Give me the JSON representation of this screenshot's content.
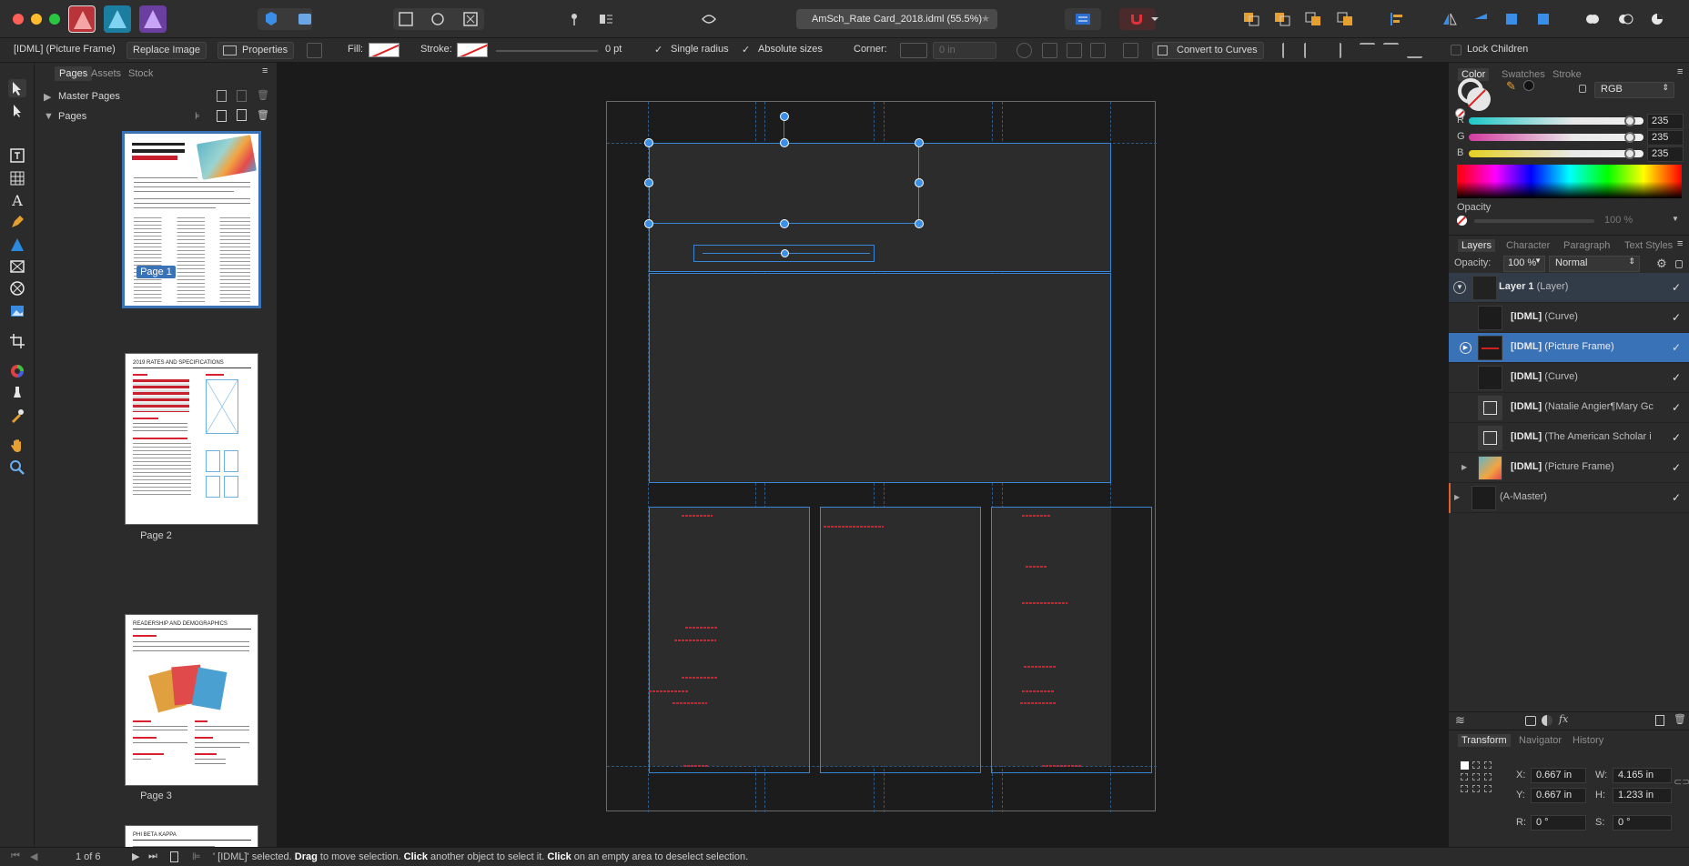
{
  "window": {
    "document_tab": "AmSch_Rate Card_2018.idml (55.5%)"
  },
  "context_toolbar": {
    "selection_type": "[IDML] (Picture Frame)",
    "replace_image": "Replace Image",
    "properties": "Properties",
    "fill_label": "Fill:",
    "stroke_label": "Stroke:",
    "stroke_value": "0 pt",
    "single_radius": "Single radius",
    "absolute_sizes": "Absolute sizes",
    "corner_label": "Corner:",
    "corner_value": "0 in",
    "convert_to_curves": "Convert to Curves",
    "lock_children": "Lock Children"
  },
  "pages_panel": {
    "tabs": [
      "Pages",
      "Assets",
      "Stock"
    ],
    "master_pages": "Master Pages",
    "pages": "Pages",
    "page_labels": [
      "Page 1",
      "Page 2",
      "Page 3"
    ],
    "thumb_titles": {
      "page2": "2019 RATES AND SPECIFICATIONS",
      "page3": "READERSHIP AND DEMOGRAPHICS",
      "page4": "PHI BETA KAPPA"
    }
  },
  "color_panel": {
    "tabs": [
      "Color",
      "Swatches",
      "Stroke"
    ],
    "mode": "RGB",
    "r_label": "R",
    "g_label": "G",
    "b_label": "B",
    "r": "235",
    "g": "235",
    "b": "235",
    "r_fraction": 0.92,
    "g_fraction": 0.92,
    "b_fraction": 0.92,
    "opacity_label": "Opacity",
    "opacity_value": "100 %"
  },
  "layers_panel": {
    "tabs": [
      "Layers",
      "Character",
      "Paragraph",
      "Text Styles"
    ],
    "opacity_label": "Opacity:",
    "opacity_value": "100 %",
    "blend_mode": "Normal",
    "layers": [
      {
        "name": "Layer 1",
        "type": "(Layer)"
      },
      {
        "name": "[IDML]",
        "type": "(Curve)"
      },
      {
        "name": "[IDML]",
        "type": "(Picture Frame)"
      },
      {
        "name": "[IDML]",
        "type": "(Curve)"
      },
      {
        "name": "[IDML]",
        "type": "(Natalie Angier¶Mary Gc"
      },
      {
        "name": "[IDML]",
        "type": "(The American Scholar i"
      },
      {
        "name": "[IDML]",
        "type": "(Picture Frame)"
      },
      {
        "name": "",
        "type": "(A-Master)"
      }
    ]
  },
  "transform_panel": {
    "tabs": [
      "Transform",
      "Navigator",
      "History"
    ],
    "x_label": "X:",
    "y_label": "Y:",
    "w_label": "W:",
    "h_label": "H:",
    "r_label": "R:",
    "s_label": "S:",
    "x": "0.667 in",
    "y": "0.667 in",
    "w": "4.165 in",
    "h": "1.233 in",
    "r": "0 °",
    "s": "0 °"
  },
  "status_bar": {
    "page_indicator": "1 of 6",
    "message_start": "' [IDML]' selected. ",
    "drag": "Drag",
    "message_mid1": " to move selection. ",
    "click1": "Click",
    "message_mid2": " another object to select it. ",
    "click2": "Click",
    "message_end": " on an empty area to deselect selection."
  },
  "colors": {
    "accent": "#3a72b8",
    "handle": "#3a8fe6",
    "red_text": "#e01c2a"
  }
}
